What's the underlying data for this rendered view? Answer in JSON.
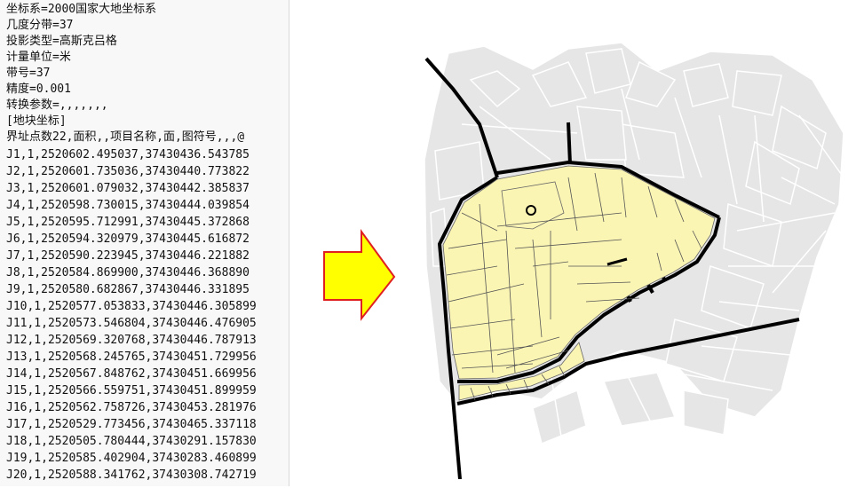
{
  "file_text": {
    "header_lines": [
      "坐标系=2000国家大地坐标系",
      "几度分带=37",
      "投影类型=高斯克吕格",
      "计量单位=米",
      "带号=37",
      "精度=0.001",
      "转换参数=,,,,,,,",
      "[地块坐标]",
      "界址点数22,面积,,项目名称,面,图符号,,,@"
    ],
    "coordinate_lines": [
      "J1,1,2520602.495037,37430436.543785",
      "J2,1,2520601.735036,37430440.773822",
      "J3,1,2520601.079032,37430442.385837",
      "J4,1,2520598.730015,37430444.039854",
      "J5,1,2520595.712991,37430445.372868",
      "J6,1,2520594.320979,37430445.616872",
      "J7,1,2520590.223945,37430446.221882",
      "J8,1,2520584.869900,37430446.368890",
      "J9,1,2520580.682867,37430446.331895",
      "J10,1,2520577.053833,37430446.305899",
      "J11,1,2520573.546804,37430446.476905",
      "J12,1,2520569.320768,37430446.787913",
      "J13,1,2520568.245765,37430451.729956",
      "J14,1,2520567.848762,37430451.669956",
      "J15,1,2520566.559751,37430451.899959",
      "J16,1,2520562.758726,37430453.281976",
      "J17,1,2520529.773456,37430465.337118",
      "J18,1,2520505.780444,37430291.157830",
      "J19,1,2520585.402904,37430283.460899",
      "J20,1,2520588.341762,37430308.742719"
    ]
  },
  "colors": {
    "parcel_fill": "#fbf5b4",
    "context_fill": "#e6e6e6",
    "road": "#000000",
    "arrow_fill": "#ffff00",
    "arrow_stroke": "#e02020"
  },
  "icons": {
    "arrow": "right-arrow-icon"
  }
}
